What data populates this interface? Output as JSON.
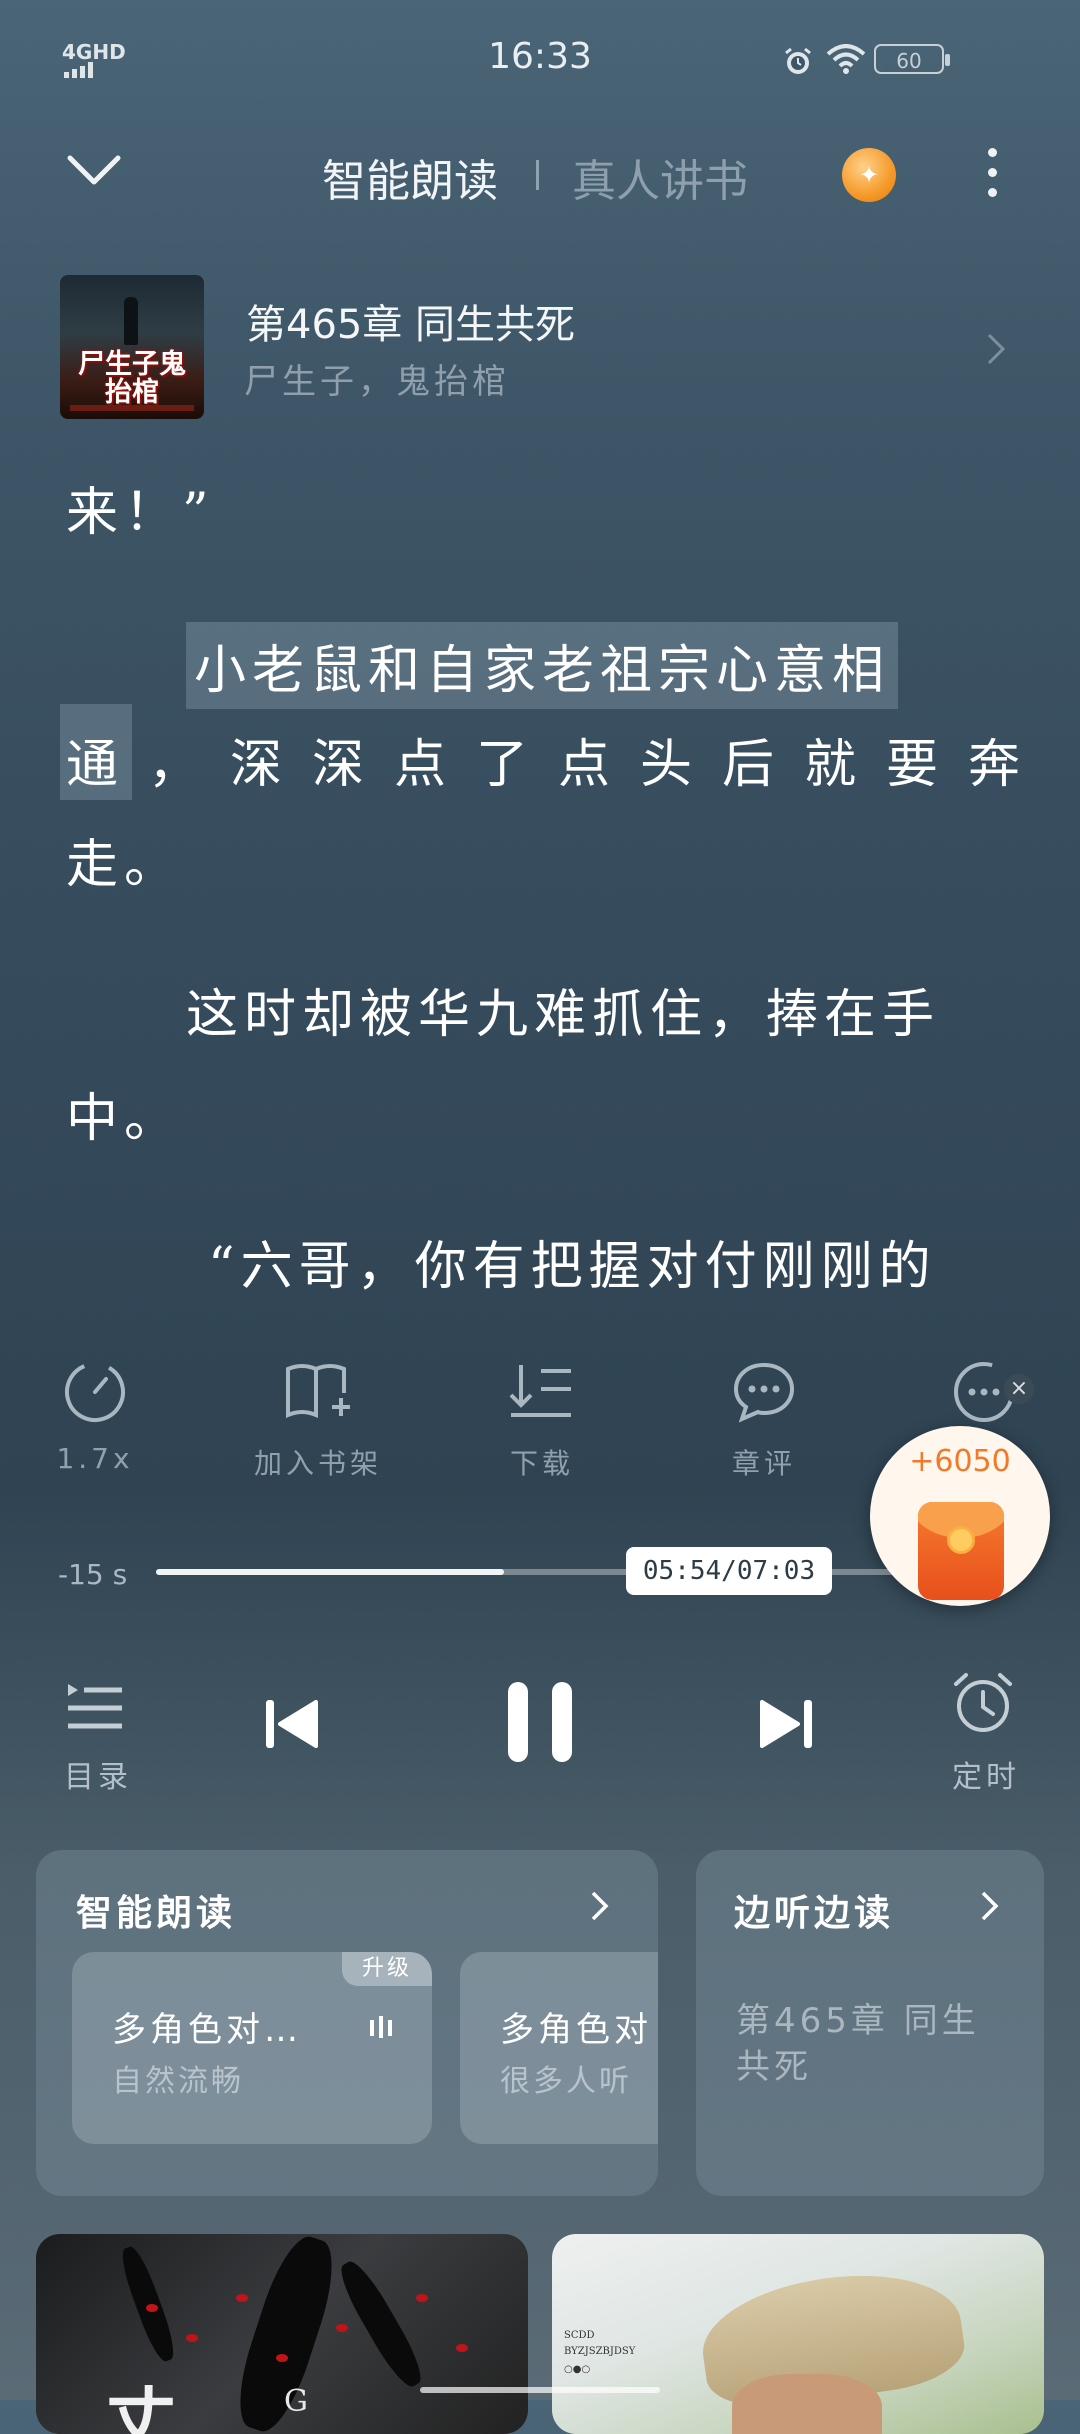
{
  "status_bar": {
    "network": "4GHD",
    "time": "16:33",
    "battery": "60"
  },
  "top_bar": {
    "tab_active": "智能朗读",
    "tab_inactive": "真人讲书",
    "coin_icon": "sparkle-coin-icon"
  },
  "chapter": {
    "cover_title": "尸生子鬼抬棺",
    "title": "第465章  同生共死",
    "book": "尸生子，鬼抬棺"
  },
  "reader": {
    "line1": "来！”",
    "p1_highlight_a": "小老鼠和自家老祖宗心意相",
    "p1_highlight_b": "通",
    "p1_rest": "，深深点了点头后就要奔",
    "p1_end": "走。",
    "p2_a": "这时却被华九难抓住，捧在手",
    "p2_b": "中。",
    "p3_a": "“六哥，你有把握对付刚刚的"
  },
  "actions": {
    "speed": "1.7x",
    "bookshelf": "加入书架",
    "download": "下载",
    "review": "章评"
  },
  "red_packet": {
    "amount": "+6050"
  },
  "progress": {
    "rewind": "-15 s",
    "time": "05:54/07:03",
    "fraction": 0.839
  },
  "player": {
    "toc": "目录",
    "timer": "定时"
  },
  "cards": {
    "smart_read": {
      "title": "智能朗读",
      "voices": [
        {
          "badge": "升级",
          "name": "多角色对…",
          "desc": "自然流畅"
        },
        {
          "name": "多角色对",
          "desc": "很多人听"
        }
      ]
    },
    "listen_read": {
      "title": "边听边读",
      "body": "第465章  同生共死"
    }
  },
  "thumbs": {
    "left_glyph": "G",
    "right_line1": "SCDD",
    "right_line2": "BYZJSZBJDSY",
    "right_line3": "○●○"
  },
  "colors": {
    "accent_orange": "#f59a2a",
    "red_packet": "#e84f1c",
    "text_primary": "#ffffff",
    "text_muted": "#8fa0ac"
  }
}
